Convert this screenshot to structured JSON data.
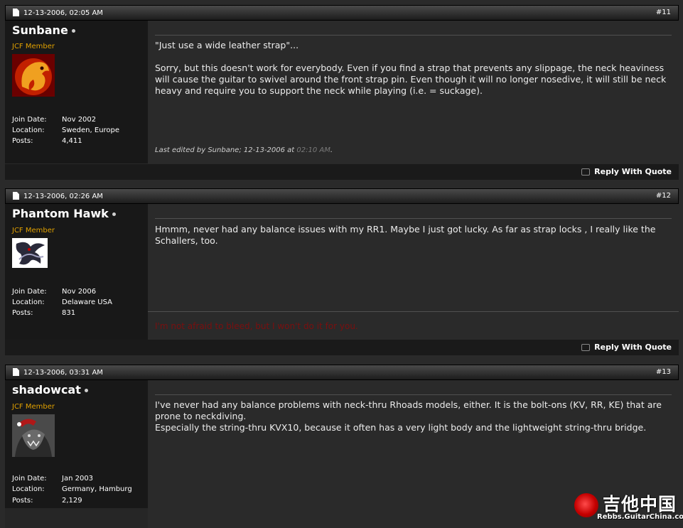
{
  "posts": [
    {
      "date": "12-13-2006, 02:05 AM",
      "number": "#11",
      "username": "Sunbane",
      "usertitle": "JCF Member",
      "join_label": "Join Date:",
      "join_date": "Nov 2002",
      "location_label": "Location:",
      "location": "Sweden, Europe",
      "posts_label": "Posts:",
      "post_count": "4,411",
      "message": "\"Just use a wide leather strap\"...\n\nSorry, but this doesn't work for everybody. Even if you find a strap that prevents any slippage, the neck heaviness will cause the guitar to swivel around the front strap pin. Even though it will no longer nosedive, it will still be neck heavy and require you to support the neck while playing (i.e. = suckage).",
      "edit_prefix": "Last edited by Sunbane; 12-13-2006 at ",
      "edit_time": "02:10 AM",
      "edit_suffix": ".",
      "reply_label": "Reply With Quote"
    },
    {
      "date": "12-13-2006, 02:26 AM",
      "number": "#12",
      "username": "Phantom Hawk",
      "usertitle": "JCF Member",
      "join_label": "Join Date:",
      "join_date": "Nov 2006",
      "location_label": "Location:",
      "location": "Delaware USA",
      "posts_label": "Posts:",
      "post_count": "831",
      "message": "Hmmm, never had any balance issues with my RR1. Maybe I just got lucky. As far as strap locks , I really like the Schallers, too.",
      "signature": "I'm not afraid to bleed, but I won't do it for you.",
      "reply_label": "Reply With Quote"
    },
    {
      "date": "12-13-2006, 03:31 AM",
      "number": "#13",
      "username": "shadowcat",
      "usertitle": "JCF Member",
      "join_label": "Join Date:",
      "join_date": "Jan 2003",
      "location_label": "Location:",
      "location": "Germany, Hamburg",
      "posts_label": "Posts:",
      "post_count": "2,129",
      "message": "I've never had any balance problems with neck-thru Rhoads models, either. It is the bolt-ons (KV, RR, KE) that are prone to neckdiving.\nEspecially the string-thru KVX10, because it often has a very light body and the lightweight string-thru bridge."
    }
  ],
  "watermark": {
    "chinese": "吉他中国",
    "url": "Rebbs.GuitarChina.com"
  },
  "colors": {
    "usertitle": "#e0a000",
    "signature": "#7a0f0f",
    "header": "#2e2e2e"
  }
}
